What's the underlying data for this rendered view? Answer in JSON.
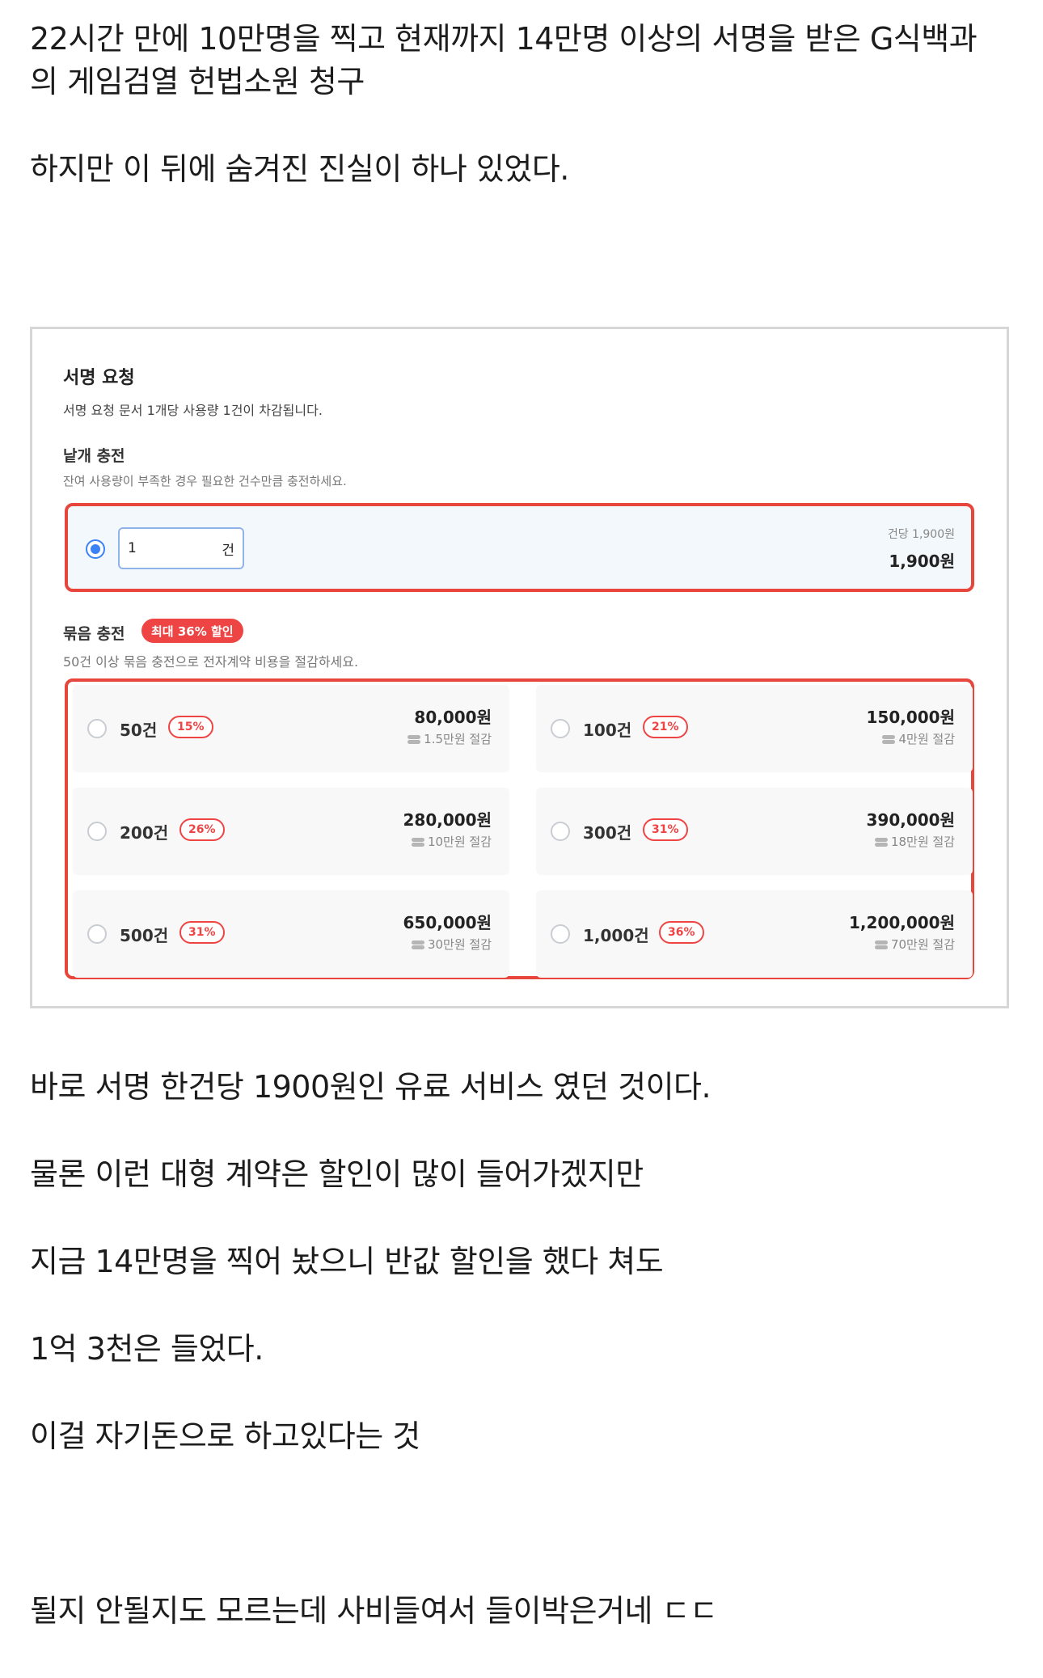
{
  "intro": {
    "line1": "22시간 만에 10만명을 찍고 현재까지 14만명 이상의 서명을 받은 G식백과",
    "line2": "의 게임검열 헌법소원 청구",
    "line3": "하지만 이 뒤에 숨겨진 진실이 하나 있었다."
  },
  "panel": {
    "title": "서명 요청",
    "description": "서명 요청 문서 1개당 사용량 1건이 차감됩니다.",
    "single": {
      "title": "낱개 충전",
      "description": "잔여 사용량이 부족한 경우 필요한 건수만큼 충전하세요.",
      "quantity": "1",
      "unit": "건",
      "unit_price": "건당 1,900원",
      "total": "1,900원"
    },
    "bundle": {
      "title": "묶음 충전",
      "badge": "최대 36% 할인",
      "description": "50건 이상 묶음 충전으로 전자계약 비용을 절감하세요.",
      "options": [
        {
          "count": "50건",
          "discount": "15%",
          "price": "80,000원",
          "saving": "1.5만원 절감"
        },
        {
          "count": "100건",
          "discount": "21%",
          "price": "150,000원",
          "saving": "4만원 절감"
        },
        {
          "count": "200건",
          "discount": "26%",
          "price": "280,000원",
          "saving": "10만원 절감"
        },
        {
          "count": "300건",
          "discount": "31%",
          "price": "390,000원",
          "saving": "18만원 절감"
        },
        {
          "count": "500건",
          "discount": "31%",
          "price": "650,000원",
          "saving": "30만원 절감"
        },
        {
          "count": "1,000건",
          "discount": "36%",
          "price": "1,200,000원",
          "saving": "70만원 절감"
        }
      ]
    }
  },
  "outro": {
    "p1": "바로 서명 한건당 1900원인 유료 서비스 였던 것이다.",
    "p2": "물론 이런 대형 계약은 할인이 많이 들어가겠지만",
    "p3": "지금 14만명을 찍어 놨으니 반값 할인을 했다 쳐도",
    "p4": "1억 3천은 들었다.",
    "p5": "이걸 자기돈으로 하고있다는 것",
    "p6": "될지 안될지도 모르는데 사비들여서 들이박은거네 ㄷㄷ"
  },
  "colors": {
    "accent_red": "#e8453c",
    "radio_blue": "#3b82f6",
    "selected_bg": "#f3f8fd"
  }
}
